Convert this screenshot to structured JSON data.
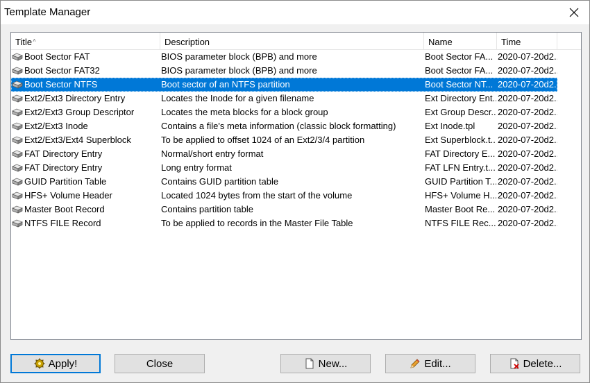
{
  "window": {
    "title": "Template Manager"
  },
  "columns": [
    {
      "key": "title",
      "label": "Title",
      "sort_glyph": "˄"
    },
    {
      "key": "description",
      "label": "Description"
    },
    {
      "key": "name",
      "label": "Name"
    },
    {
      "key": "time",
      "label": "Time"
    }
  ],
  "rows": [
    {
      "title": "Boot Sector FAT",
      "description": "BIOS parameter block (BPB) and more",
      "name": "Boot Sector FA...",
      "time": "2020-07-20d2...",
      "selected": false
    },
    {
      "title": "Boot Sector FAT32",
      "description": "BIOS parameter block (BPB) and more",
      "name": "Boot Sector FA...",
      "time": "2020-07-20d2...",
      "selected": false
    },
    {
      "title": "Boot Sector NTFS",
      "description": "Boot sector of an NTFS partition",
      "name": "Boot Sector NT...",
      "time": "2020-07-20d2...",
      "selected": true
    },
    {
      "title": "Ext2/Ext3 Directory Entry",
      "description": "Locates the Inode for a given filename",
      "name": "Ext Directory Ent...",
      "time": "2020-07-20d2...",
      "selected": false
    },
    {
      "title": "Ext2/Ext3 Group Descriptor",
      "description": "Locates the meta blocks for a block group",
      "name": "Ext Group Descr...",
      "time": "2020-07-20d2...",
      "selected": false
    },
    {
      "title": "Ext2/Ext3 Inode",
      "description": "Contains a file's meta information (classic block formatting)",
      "name": "Ext Inode.tpl",
      "time": "2020-07-20d2...",
      "selected": false
    },
    {
      "title": "Ext2/Ext3/Ext4 Superblock",
      "description": "To be applied to offset 1024 of an Ext2/3/4 partition",
      "name": "Ext Superblock.t...",
      "time": "2020-07-20d2...",
      "selected": false
    },
    {
      "title": "FAT Directory Entry",
      "description": "Normal/short entry format",
      "name": "FAT Directory E...",
      "time": "2020-07-20d2...",
      "selected": false
    },
    {
      "title": "FAT Directory Entry",
      "description": "Long entry format",
      "name": "FAT LFN Entry.t...",
      "time": "2020-07-20d2...",
      "selected": false
    },
    {
      "title": "GUID Partition Table",
      "description": "Contains GUID partition table",
      "name": "GUID Partition T...",
      "time": "2020-07-20d2...",
      "selected": false
    },
    {
      "title": "HFS+ Volume Header",
      "description": "Located 1024 bytes from the start of the volume",
      "name": "HFS+ Volume H...",
      "time": "2020-07-20d2...",
      "selected": false
    },
    {
      "title": "Master Boot Record",
      "description": "Contains partition table",
      "name": "Master Boot Re...",
      "time": "2020-07-20d2...",
      "selected": false
    },
    {
      "title": "NTFS FILE Record",
      "description": "To be applied to records in the Master File Table",
      "name": "NTFS FILE Rec...",
      "time": "2020-07-20d2...",
      "selected": false
    }
  ],
  "buttons": {
    "apply": {
      "label": "Apply!",
      "icon": "apply-icon"
    },
    "close": {
      "label": "Close"
    },
    "new": {
      "label": "New...",
      "icon": "document-icon"
    },
    "edit": {
      "label": "Edit...",
      "icon": "pencil-icon"
    },
    "delete": {
      "label": "Delete...",
      "icon": "delete-document-icon"
    }
  },
  "colors": {
    "selection": "#0078d7",
    "default_button_border": "#0078d7",
    "button_face": "#e1e1e1"
  }
}
